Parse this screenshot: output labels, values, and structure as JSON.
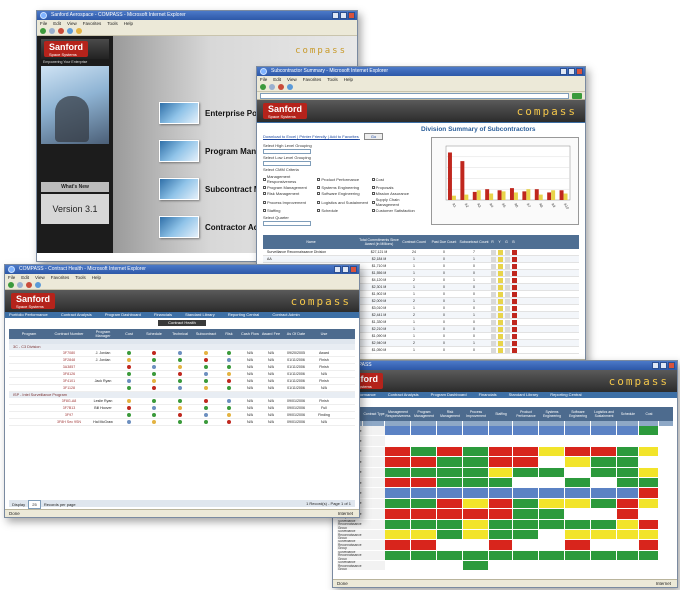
{
  "window_home": {
    "title": "Sanford Aerospace - COMPASS - Microsoft Internet Explorer",
    "brand": "Sanford",
    "brand_sub": "Space Systems",
    "brand_tagline": "Empowering Your Enterprise",
    "product": "compass",
    "whats_new": "What's New",
    "version": "Version 3.1",
    "entries": [
      {
        "label": "Enterprise Portfolio"
      },
      {
        "label": "Program Manager"
      },
      {
        "label": "Subcontract Manager"
      },
      {
        "label": "Contractor Access"
      }
    ]
  },
  "window_summary": {
    "title": "Subcontractor Summary - Microsoft Internet Explorer",
    "brand": "Sanford",
    "product": "compass",
    "heading": "Division Summary of Subcontractors",
    "links": [
      "Download to Excel",
      "Printer Friendly",
      "Add to Favorites"
    ],
    "go": "Go",
    "filters": {
      "label1": "Select High Level Grouping",
      "value1": "Division",
      "label2": "Select Low Level Grouping",
      "value2": "Subcontractors",
      "label3": "Select CMM Criteria",
      "label4": "Select Quarter",
      "value4": "All Quarters"
    },
    "criteria": [
      "Management Responsiveness",
      "Product Performance",
      "Cost",
      "Program Management",
      "Systems Engineering",
      "Proposals",
      "Risk Management",
      "Software Engineering",
      "Mission Assurance",
      "Process Improvement",
      "Logistics and Sustainment",
      "Supply Chain Management",
      "Staffing",
      "Schedule",
      "Customer Satisfaction"
    ],
    "table_headers": [
      "Name",
      "Total Commitments Since Award (in Millions)",
      "Contract Count",
      "Past Due Count",
      "Subcontract Count",
      "R",
      "Y",
      "G",
      "B"
    ],
    "rows": [
      {
        "name": "Surveillance Reconnaissance Division",
        "total": "$27,121 M",
        "contracts": "24",
        "past_due": "0",
        "subs": "7"
      },
      {
        "name": "AA",
        "total": "$2,184 M",
        "contracts": "1",
        "past_due": "0",
        "subs": "1"
      },
      {
        "name": "",
        "total": "$1,710 M",
        "contracts": "1",
        "past_due": "0",
        "subs": "0"
      },
      {
        "name": "Ball Aerospace",
        "total": "$1,556 M",
        "contracts": "1",
        "past_due": "0",
        "subs": "0"
      },
      {
        "name": "Bendix Company",
        "total": "$4,120 M",
        "contracts": "2",
        "past_due": "0",
        "subs": "1"
      },
      {
        "name": "Consolidated",
        "total": "$2,301 M",
        "contracts": "1",
        "past_due": "0",
        "subs": "0"
      },
      {
        "name": "Company",
        "total": "$1,902 M",
        "contracts": "1",
        "past_due": "0",
        "subs": "0"
      },
      {
        "name": "Advanced",
        "total": "$2,009 M",
        "contracts": "2",
        "past_due": "0",
        "subs": "1"
      },
      {
        "name": "",
        "total": "$3,010 M",
        "contracts": "1",
        "past_due": "0",
        "subs": "0"
      },
      {
        "name": "Companies",
        "total": "$2,441 M",
        "contracts": "2",
        "past_due": "0",
        "subs": "1"
      },
      {
        "name": "",
        "total": "$1,330 M",
        "contracts": "1",
        "past_due": "0",
        "subs": "0"
      },
      {
        "name": "ture",
        "total": "$2,210 M",
        "contracts": "1",
        "past_due": "0",
        "subs": "0"
      },
      {
        "name": "",
        "total": "$1,090 M",
        "contracts": "1",
        "past_due": "0",
        "subs": "0"
      },
      {
        "name": "",
        "total": "$2,940 M",
        "contracts": "2",
        "past_due": "0",
        "subs": "1"
      },
      {
        "name": "",
        "total": "$1,050 M",
        "contracts": "1",
        "past_due": "0",
        "subs": "0"
      }
    ],
    "status": "Internet"
  },
  "chart_data": {
    "type": "bar",
    "title": "",
    "ylabel": "",
    "categories": [
      "A1",
      "A2",
      "A3",
      "A4",
      "A5",
      "A6",
      "A7",
      "A8",
      "A9",
      "A10"
    ],
    "series": [
      {
        "values": [
          88,
          72,
          15,
          20,
          18,
          22,
          16,
          20,
          14,
          18
        ]
      },
      {
        "values": [
          8,
          10,
          18,
          12,
          16,
          14,
          20,
          10,
          18,
          12
        ]
      }
    ],
    "ylim": [
      0,
      100
    ],
    "colors": [
      "#c0271e",
      "#e8d44a"
    ]
  },
  "window_health": {
    "title": "COMPASS - Contract Health - Microsoft Internet Explorer",
    "brand": "Sanford",
    "product": "compass",
    "nav": [
      "Portfolio Performance",
      "Contract Analysis",
      "Program Dashboard",
      "Financials",
      "Standard Library",
      "Reporting Central",
      "Contract Admin"
    ],
    "subheader": "Contract Health",
    "columns": [
      "Program",
      "Contract Number",
      "Program Manager",
      "Cost",
      "Schedule",
      "Technical",
      "Subcontract",
      "Risk",
      "Cash Flow",
      "Award Fee",
      "As Of Date",
      "Use"
    ],
    "groups": [
      {
        "label": "3C - C3 Division"
      },
      {
        "label": "ISP - Intel Surveillance Program"
      }
    ],
    "rows": [
      {
        "contract": "3F7080",
        "pm": "J. Jordan",
        "cf": "N/A",
        "date": "09/20/2005",
        "use": "Award"
      },
      {
        "contract": "3F2848",
        "pm": "J. Jordan",
        "cf": "N/A",
        "date": "01/11/2006",
        "use": "Finish"
      },
      {
        "contract": "3A3857",
        "pm": "",
        "cf": "N/A",
        "date": "01/11/2006",
        "use": "Finish"
      },
      {
        "contract": "3F8126",
        "pm": "",
        "cf": "N/A",
        "date": "01/11/2006",
        "use": "N/A"
      },
      {
        "contract": "3F4101",
        "pm": "Jack Ryan",
        "cf": "N/A",
        "date": "01/11/2006",
        "use": "Finish"
      },
      {
        "contract": "3F1128",
        "pm": "",
        "cf": "N/A",
        "date": "01/11/2006",
        "use": "N/A"
      },
      {
        "contract": "3F8G-A8",
        "pm": "Leslie Ryan",
        "cf": "N/A",
        "date": "09/01/2006",
        "use": "Finish"
      },
      {
        "contract": "3F7B13",
        "pm": "Bill Hoover",
        "cf": "N/A",
        "date": "09/01/2006",
        "use": "Full"
      },
      {
        "contract": "3F97",
        "pm": "",
        "cf": "N/A",
        "date": "09/01/2006",
        "use": "Finding"
      },
      {
        "contract": "3F8H Sec 9SN",
        "pm": "Hal McGraw",
        "cf": "N/A",
        "date": "09/01/2006",
        "use": "N/A"
      }
    ],
    "pager": "Display",
    "pager_size": "25",
    "pager_text": "Records per page",
    "pager_right": "1 Record(s) - Page 1 of 1",
    "status": "Done",
    "zone": "Internet"
  },
  "window_heatmap": {
    "title": "COMPASS",
    "brand": "Sanford",
    "product": "compass",
    "legend_link": "Show Key",
    "columns": [
      "Division",
      "Contract Type",
      "Management Responsiveness",
      "Program Management",
      "Risk Management",
      "Process Improvement",
      "Staffing",
      "Product Performance",
      "Systems Engineering",
      "Software Engineering",
      "Logistics and Sustainment",
      "Schedule",
      "Cost"
    ],
    "row_labels": [
      "Surveillance Reconnaissance Group",
      "Surveillance Reconnaissance Group",
      "Surveillance Reconnaissance Group",
      "Surveillance Reconnaissance Group",
      "Surveillance Reconnaissance Group",
      "Surveillance Reconnaissance Group",
      "Surveillance Reconnaissance Group",
      "Surveillance Reconnaissance Group",
      "Surveillance Reconnaissance Group",
      "Surveillance Reconnaissance Group",
      "Surveillance Reconnaissance Group",
      "Surveillance Reconnaissance Group",
      "Surveillance Reconnaissance Group",
      "Surveillance Reconnaissance Group"
    ],
    "status": "Done",
    "zone": "Internet"
  }
}
